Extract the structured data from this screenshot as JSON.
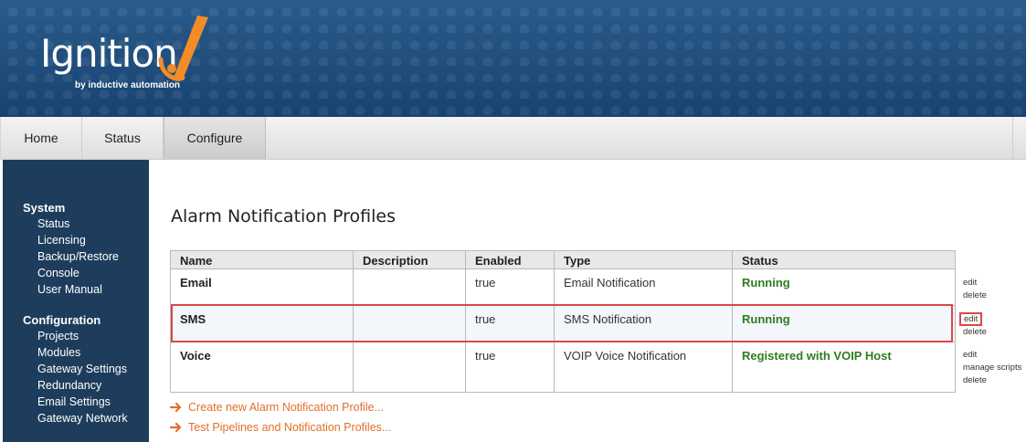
{
  "brand": {
    "name": "Ignition",
    "tagline": "by inductive automation",
    "accent": "#f28c28"
  },
  "tabs": [
    {
      "label": "Home"
    },
    {
      "label": "Status"
    },
    {
      "label": "Configure",
      "selected": true
    }
  ],
  "sidebar": {
    "sections": [
      {
        "title": "System",
        "items": [
          "Status",
          "Licensing",
          "Backup/Restore",
          "Console",
          "User Manual"
        ]
      },
      {
        "title": "Configuration",
        "items": [
          "Projects",
          "Modules",
          "Gateway Settings",
          "Redundancy",
          "Email Settings",
          "Gateway Network"
        ]
      }
    ]
  },
  "page": {
    "title": "Alarm Notification Profiles"
  },
  "table": {
    "columns": [
      "Name",
      "Description",
      "Enabled",
      "Type",
      "Status"
    ],
    "rows": [
      {
        "name": "Email",
        "description": "",
        "enabled": "true",
        "type": "Email Notification",
        "status": "Running",
        "actions": [
          "edit",
          "delete"
        ]
      },
      {
        "name": "SMS",
        "description": "",
        "enabled": "true",
        "type": "SMS Notification",
        "status": "Running",
        "actions": [
          "edit",
          "delete"
        ]
      },
      {
        "name": "Voice",
        "description": "",
        "enabled": "true",
        "type": "VOIP Voice Notification",
        "status": "Registered with VOIP Host",
        "actions": [
          "edit",
          "manage scripts",
          "delete"
        ]
      }
    ]
  },
  "links": {
    "create": "Create new Alarm Notification Profile...",
    "test": "Test Pipelines and Notification Profiles..."
  },
  "colors": {
    "header_bg": "#1d4a78",
    "sidebar_bg": "#1e3d5c",
    "status_running": "#2e7d1f",
    "link": "#e0702a",
    "highlight": "#d94848"
  }
}
